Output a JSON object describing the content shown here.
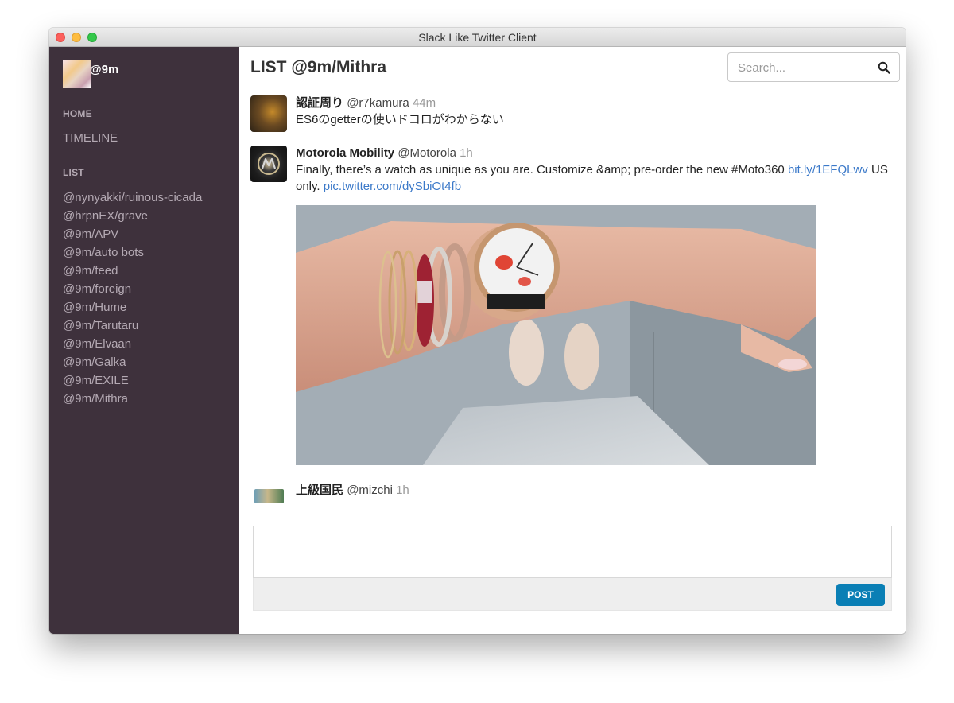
{
  "window": {
    "title": "Slack Like Twitter Client"
  },
  "sidebar": {
    "user": {
      "name": "@9m"
    },
    "home_label": "HOME",
    "timeline_label": "TIMELINE",
    "list_heading": "LIST",
    "lists": [
      "@nynyakki/ruinous-cicada",
      "@hrpnEX/grave",
      "@9m/APV",
      "@9m/auto bots",
      "@9m/feed",
      "@9m/foreign",
      "@9m/Hume",
      "@9m/Tarutaru",
      "@9m/Elvaan",
      "@9m/Galka",
      "@9m/EXILE",
      "@9m/Mithra"
    ]
  },
  "header": {
    "title": "LIST @9m/Mithra",
    "search_placeholder": "Search..."
  },
  "tweets": [
    {
      "name": "認証周り",
      "handle": "@r7kamura",
      "time": "44m",
      "text": "ES6のgetterの使いドコロがわからない"
    },
    {
      "name": "Motorola Mobility",
      "handle": "@Motorola",
      "time": "1h",
      "text_before": "Finally, there’s a watch as unique as you are. Customize &amp; pre-order the new #Moto360 ",
      "link1": "bit.ly/1EFQLwv",
      "text_middle": " US only. ",
      "link2": "pic.twitter.com/dySbiOt4fb"
    },
    {
      "name": "上級国民",
      "handle": "@mizchi",
      "time": "1h"
    }
  ],
  "composer": {
    "post_label": "POST"
  },
  "colors": {
    "sidebar_bg": "#3e313c",
    "post_button": "#0a7fb5",
    "link": "#3b79c9"
  }
}
